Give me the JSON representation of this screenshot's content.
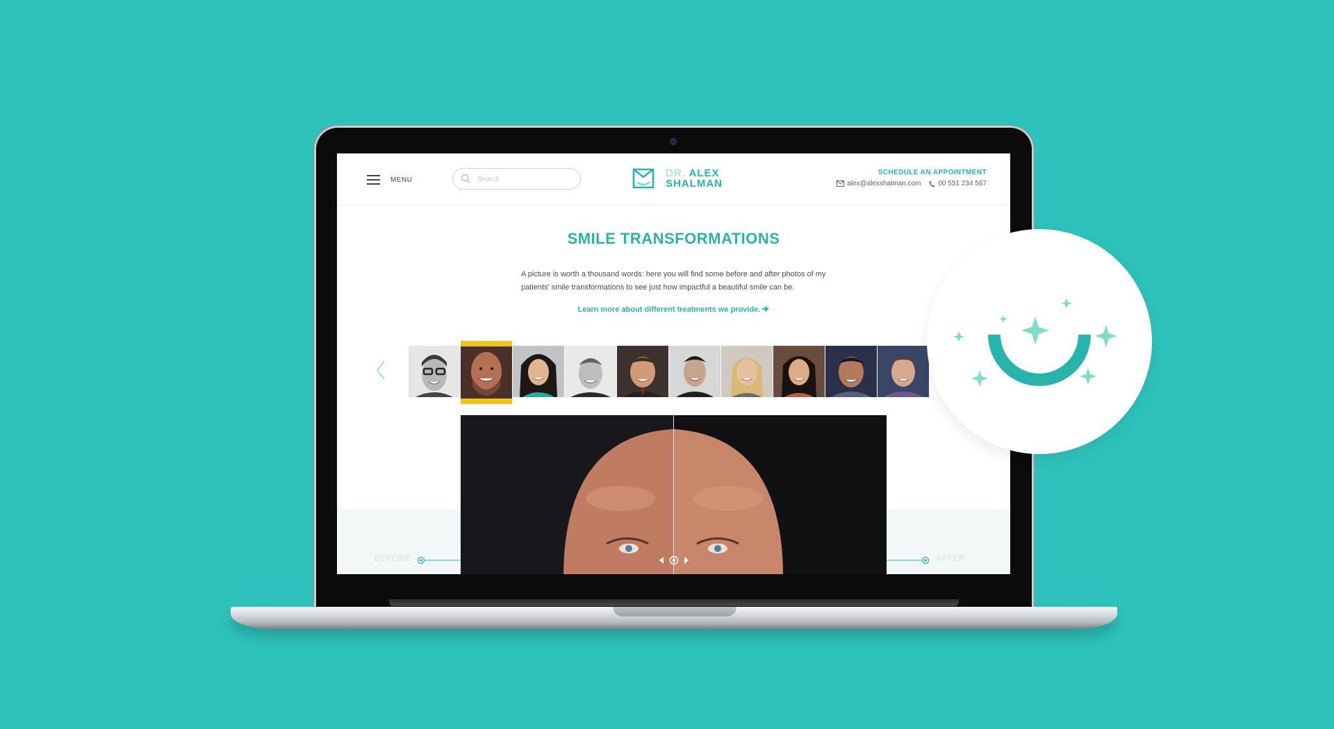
{
  "header": {
    "menu_label": "MENU",
    "search_placeholder": "Search",
    "logo": {
      "dr": "DR.",
      "first": "ALEX",
      "last": "SHALMAN"
    },
    "appointment_label": "SCHEDULE AN APPOINTMENT",
    "email": "alex@alexshalman.com",
    "phone": "00 551 234 567"
  },
  "main": {
    "title": "SMILE TRANSFORMATIONS",
    "description": "A picture is worth a thousand words: here you will find some before and after photos of my patients' smile transformations to see just how impactful a beautiful smile can be.",
    "learn_more": "Learn more about different treatments we provide.",
    "before_label": "BEFORE",
    "after_label": "AFTER",
    "selected_thumbnail_index": 1
  },
  "colors": {
    "accent": "#27b4ad",
    "background": "#2ec2bc",
    "selection": "#f2c318",
    "sparkle": "#7fdcc8"
  },
  "icons": [
    "menu-icon",
    "search-icon",
    "tooth-logo-icon",
    "envelope-icon",
    "phone-icon",
    "chevron-left-icon",
    "arrow-right-icon",
    "smile-sparkles-icon"
  ]
}
